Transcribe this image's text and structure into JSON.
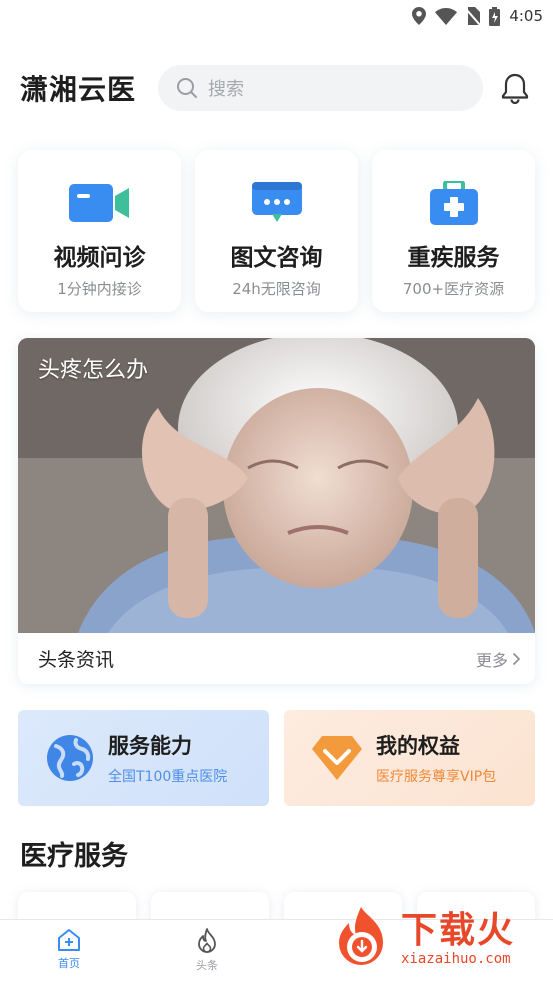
{
  "status_bar": {
    "time": "4:05"
  },
  "header": {
    "app_title": "潇湘云医",
    "search_placeholder": "搜索"
  },
  "services": [
    {
      "title": "视频问诊",
      "subtitle": "1分钟内接诊",
      "icon": "video-camera-icon",
      "color": "#3a8df0"
    },
    {
      "title": "图文咨询",
      "subtitle": "24h无限咨询",
      "icon": "chat-bubble-icon",
      "color": "#3a8df0"
    },
    {
      "title": "重疾服务",
      "subtitle": "700+医疗资源",
      "icon": "medical-kit-icon",
      "color": "#3a8df0"
    }
  ],
  "banner": {
    "caption": "头疼怎么办",
    "section_label": "头条资讯",
    "more_label": "更多"
  },
  "features": [
    {
      "title": "服务能力",
      "subtitle": "全国T100重点医院",
      "icon": "globe-icon",
      "color": "#4f8fe8"
    },
    {
      "title": "我的权益",
      "subtitle": "医疗服务尊享VIP包",
      "icon": "diamond-icon",
      "color": "#f08a3a"
    }
  ],
  "medical_section_title": "医疗服务",
  "tabbar": {
    "items": [
      {
        "label": "首页",
        "active": true
      },
      {
        "label": "头条",
        "active": false
      }
    ]
  },
  "watermark": {
    "cn": "下载火",
    "en": "xiazaihuo.com"
  }
}
